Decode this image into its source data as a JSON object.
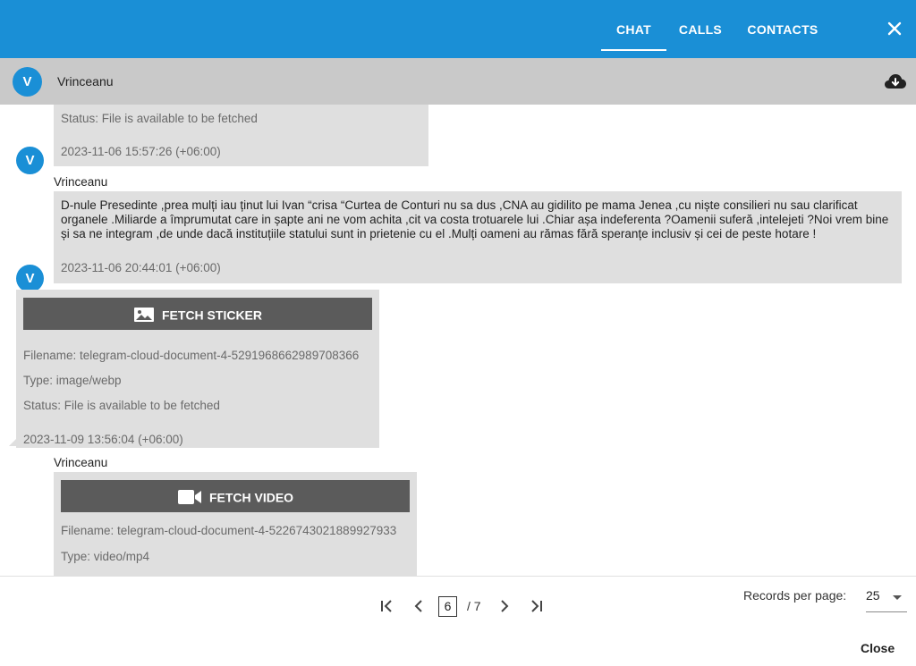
{
  "tabs": [
    {
      "label": "CHAT"
    },
    {
      "label": "CALLS"
    },
    {
      "label": "CONTACTS"
    }
  ],
  "header": {
    "avatar_letter": "V",
    "name": "Vrinceanu"
  },
  "messages": {
    "m1": {
      "status": "Status: File is available to be fetched",
      "time": "2023-11-06 15:57:26 (+06:00)"
    },
    "m2": {
      "avatar_letter": "V",
      "sender": "Vrinceanu",
      "text": "D-nule Presedinte ,prea mulți iau ținut lui Ivan “crisa “Curtea de Conturi nu sa dus ,CNA au gidilito pe mama Jenea ,cu niște consilieri nu sau clarificat organele .Miliarde a împrumutat care in șapte ani ne vom achita ,cit va costa trotuarele lui .Chiar așa indeferenta ?Oamenii suferă ,intelejeti ?Noi vrem bine și sa ne integram ,de unde dacă instituțiile statului sunt in prietenie cu el .Mulți oameni au rămas fără speranțe inclusiv și cei de peste hotare !",
      "time": "2023-11-06 20:44:01 (+06:00)"
    },
    "m3": {
      "avatar_letter": "V",
      "button": "FETCH STICKER",
      "filename": "Filename: telegram-cloud-document-4-5291968662989708366",
      "type": "Type: image/webp",
      "status": "Status: File is available to be fetched",
      "time": "2023-11-09 13:56:04 (+06:00)"
    },
    "m4": {
      "sender": "Vrinceanu",
      "button": "FETCH VIDEO",
      "filename": "Filename: telegram-cloud-document-4-5226743021889927933",
      "type": "Type: video/mp4"
    }
  },
  "pager": {
    "current": "6",
    "total": "/ 7",
    "rpp_label": "Records per page:",
    "rpp_value": "25"
  },
  "footer": {
    "close": "Close"
  },
  "colors": {
    "accent": "#1a8fd6",
    "bubble": "#dfdfdf",
    "button": "#5b5b5b"
  }
}
